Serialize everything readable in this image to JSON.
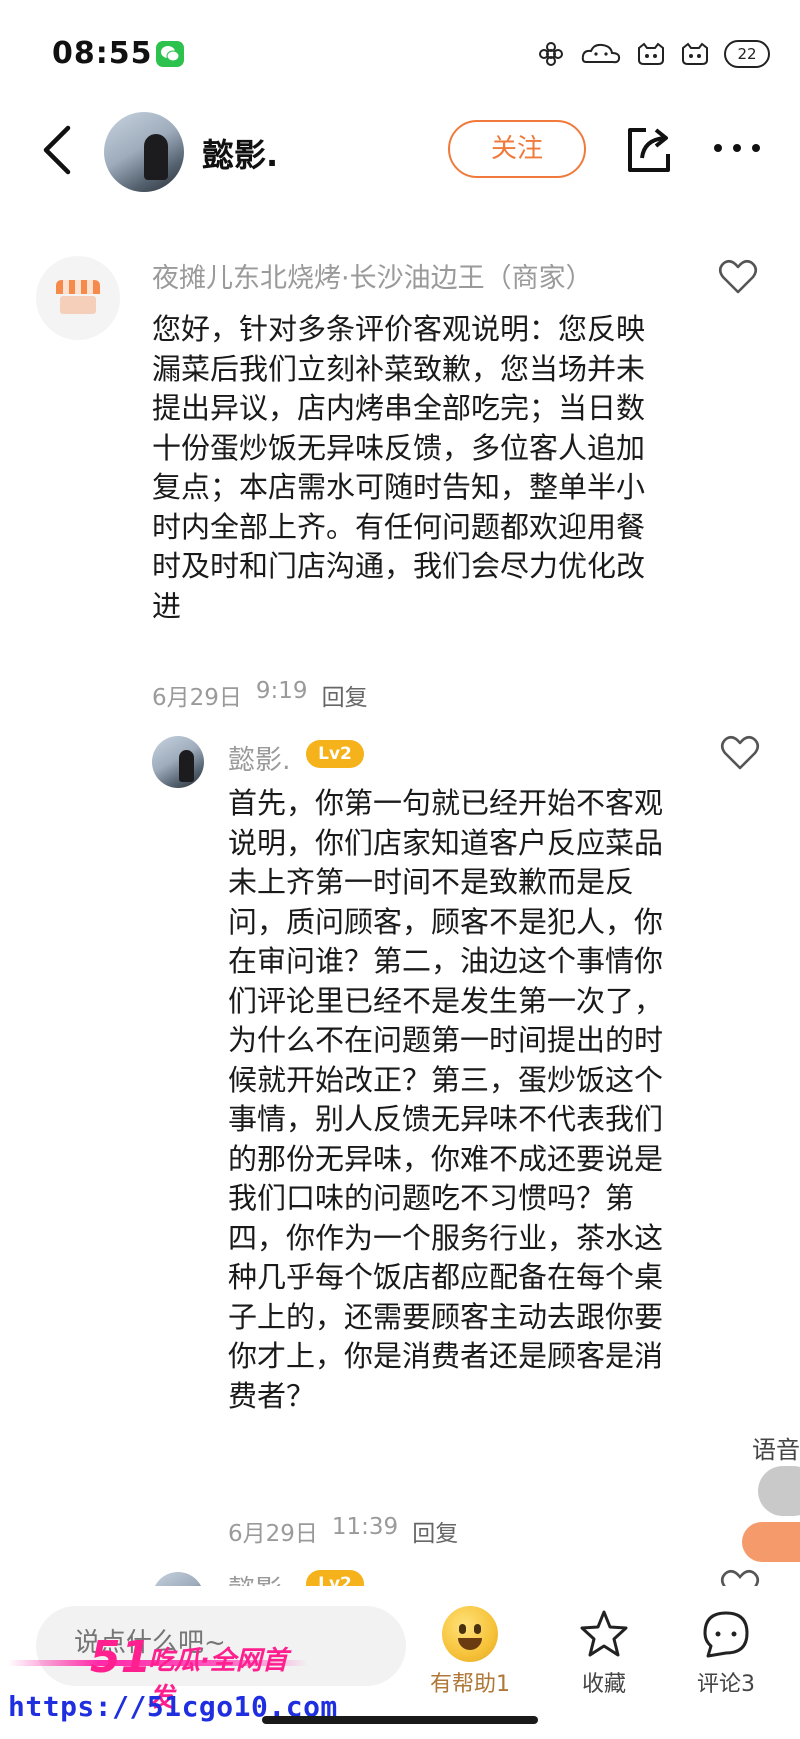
{
  "status_bar": {
    "time": "08:55",
    "battery": "22",
    "icons": [
      "wechat-icon",
      "flower-icon",
      "cloud-face-icon",
      "cat-face-icon",
      "cat-face-icon"
    ]
  },
  "header": {
    "name": "懿影.",
    "follow_label": "关注"
  },
  "merchant_comment": {
    "author": "夜摊儿东北烧烤·长沙油边王（商家）",
    "lines": [
      "您好，针对多条评价客观说明：您反映",
      "漏菜后我们立刻补菜致歉，您当场并未",
      "提出异议，店内烤串全部吃完；当日数",
      "十份蛋炒饭无异味反馈，多位客人追加",
      "复点；本店需水可随时告知，整单半小",
      "时内全部上齐。有任何问题都欢迎用餐",
      "时及时和门店沟通，我们会尽力优化改",
      "进"
    ],
    "date": "6月29日",
    "time": "9:19",
    "reply_label": "回复"
  },
  "reply_comment": {
    "author": "懿影.",
    "level": "Lv2",
    "lines": [
      "首先，你第一句就已经开始不客观",
      "说明，你们店家知道客户反应菜品",
      "未上齐第一时间不是致歉而是反",
      "问，质问顾客，顾客不是犯人，你",
      "在审问谁？第二，油边这个事情你",
      "们评论里已经不是发生第一次了，",
      "为什么不在问题第一时间提出的时",
      "候就开始改正？第三，蛋炒饭这个",
      "事情，别人反馈无异味不代表我们",
      "的那份无异味，你难不成还要说是",
      "我们口味的问题吃不习惯吗？第",
      "四，你作为一个服务行业，茶水这",
      "种几乎每个饭店都应配备在每个桌",
      "子上的，还需要顾客主动去跟你要",
      "你才上，你是消费者还是顾客是消",
      "费者？"
    ],
    "date": "6月29日",
    "time": "11:39",
    "reply_label": "回复"
  },
  "next_comment": {
    "author": "懿影",
    "level": "Lv2"
  },
  "side_float": {
    "label": "语音"
  },
  "bottom_bar": {
    "input_placeholder": "说点什么吧~",
    "helpful_label": "有帮助1",
    "favorite_label": "收藏",
    "comment_label": "评论3"
  },
  "watermark": {
    "big": "51",
    "text": "吃瓜·全网首发",
    "url": "https://51cgo10.com"
  },
  "colors": {
    "accent_orange": "#f07a3c",
    "level_badge": "#f5b21a",
    "watermark_pink": "#ff1f8e",
    "watermark_blue": "#1f2fe0"
  }
}
